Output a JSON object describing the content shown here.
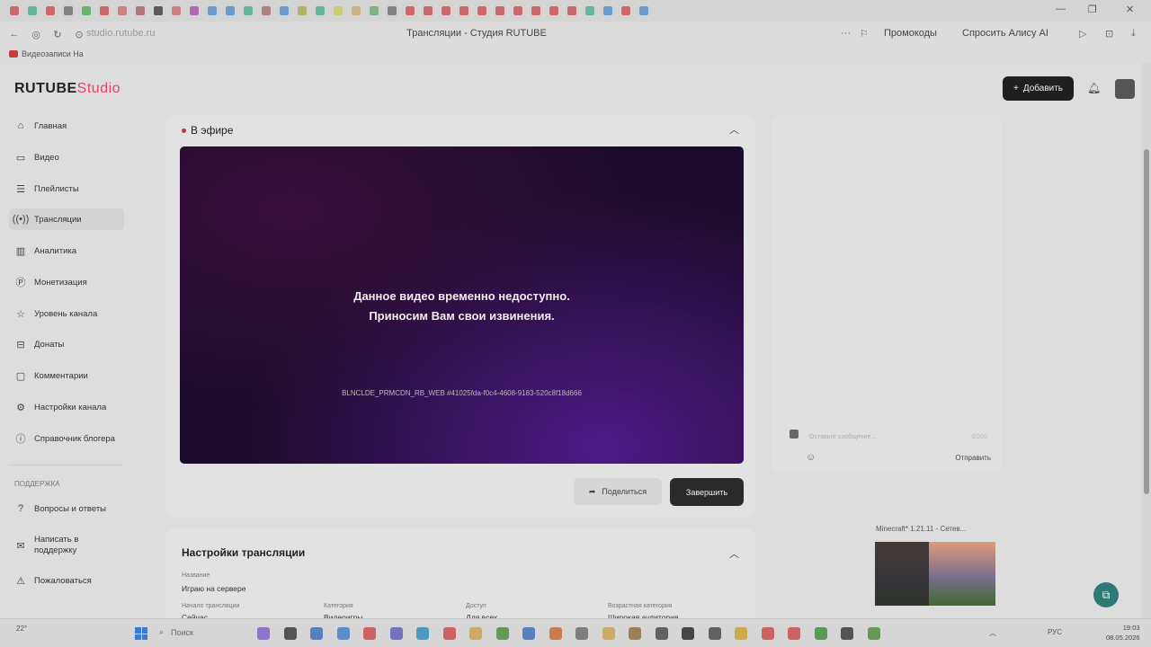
{
  "browser": {
    "url": "studio.rutube.ru",
    "tab_title": "Трансляции - Студия RUTUBE",
    "promo_label": "Промокоды",
    "alice_label": "Спросить Алису AI",
    "bookmark_label": "Видеозаписи На"
  },
  "app": {
    "logo_text": "RUTUBE",
    "logo_studio": "Studio",
    "add_button_label": "Добавить"
  },
  "sidebar": {
    "items": [
      {
        "label": "Главная",
        "icon": "home-icon"
      },
      {
        "label": "Видео",
        "icon": "video-icon"
      },
      {
        "label": "Плейлисты",
        "icon": "playlist-icon"
      },
      {
        "label": "Трансляции",
        "icon": "broadcast-icon"
      },
      {
        "label": "Аналитика",
        "icon": "analytics-icon"
      },
      {
        "label": "Монетизация",
        "icon": "monetization-icon"
      },
      {
        "label": "Уровень канала",
        "icon": "star-icon"
      },
      {
        "label": "Донаты",
        "icon": "donations-icon"
      },
      {
        "label": "Комментарии",
        "icon": "comments-icon"
      },
      {
        "label": "Настройки канала",
        "icon": "gear-icon"
      },
      {
        "label": "Справочник блогера",
        "icon": "info-icon"
      }
    ],
    "support_label": "Поддержка",
    "support_items": [
      {
        "label": "Вопросы и ответы",
        "icon": "help-icon"
      },
      {
        "label": "Написать в поддержку",
        "icon": "mail-icon"
      },
      {
        "label": "Пожаловаться",
        "icon": "report-icon"
      }
    ]
  },
  "live": {
    "status_label": "В эфире",
    "error_line1": "Данное видео временно недоступно.",
    "error_line2": "Приносим Вам свои извинения.",
    "error_code": "BLNCLDE_PRMCDN_RB_WEB #41025fda-f0c4-4608-9183-520c8f18d666",
    "share_label": "Поделиться",
    "finish_label": "Завершить"
  },
  "chat": {
    "input_placeholder": "Оставьте сообщение...",
    "counter": "0/200",
    "send_label": "Отправить"
  },
  "settings": {
    "title": "Настройки трансляции",
    "name_label": "Название",
    "name_value": "Играю на сервере",
    "fields": [
      {
        "label": "Начало трансляции",
        "value": "Сейчас"
      },
      {
        "label": "Категория",
        "value": "Видеоигры"
      },
      {
        "label": "Доступ",
        "value": "Для всех"
      },
      {
        "label": "Возрастная категория",
        "value": "Широкая аудитория"
      }
    ]
  },
  "mini_player": {
    "caption": "Minecraft* 1.21.11 - Сетев..."
  },
  "taskbar": {
    "weather": "22°",
    "search_placeholder": "Поиск",
    "lang": "РУС",
    "time": "19:03",
    "date": "08.05.2026"
  },
  "colors": {
    "live_dot": "#c2324b",
    "studio_accent": "#e0466a",
    "fab": "#2d7a74"
  }
}
